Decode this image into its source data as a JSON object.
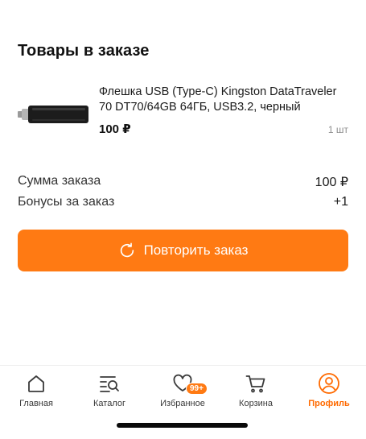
{
  "order": {
    "section_title": "Товары в заказе",
    "product": {
      "name": "Флешка USB (Type-C) Kingston DataTraveler 70 DT70/64GB 64ГБ, USB3.2, черный",
      "price": "100 ₽",
      "quantity": "1 шт"
    },
    "summary": {
      "sum_label": "Сумма заказа",
      "sum_value": "100 ₽",
      "bonus_label": "Бонусы за заказ",
      "bonus_value": "+1"
    },
    "repeat_button_label": "Повторить заказ"
  },
  "tabbar": {
    "items": [
      {
        "label": "Главная",
        "icon": "home-icon",
        "active": false
      },
      {
        "label": "Каталог",
        "icon": "catalog-search-icon",
        "active": false
      },
      {
        "label": "Избранное",
        "icon": "heart-icon",
        "active": false,
        "badge": "99+"
      },
      {
        "label": "Корзина",
        "icon": "cart-icon",
        "active": false
      },
      {
        "label": "Профиль",
        "icon": "profile-icon",
        "active": true
      }
    ]
  },
  "colors": {
    "accent": "#ff7a13",
    "active_tab": "#ff6a00"
  }
}
